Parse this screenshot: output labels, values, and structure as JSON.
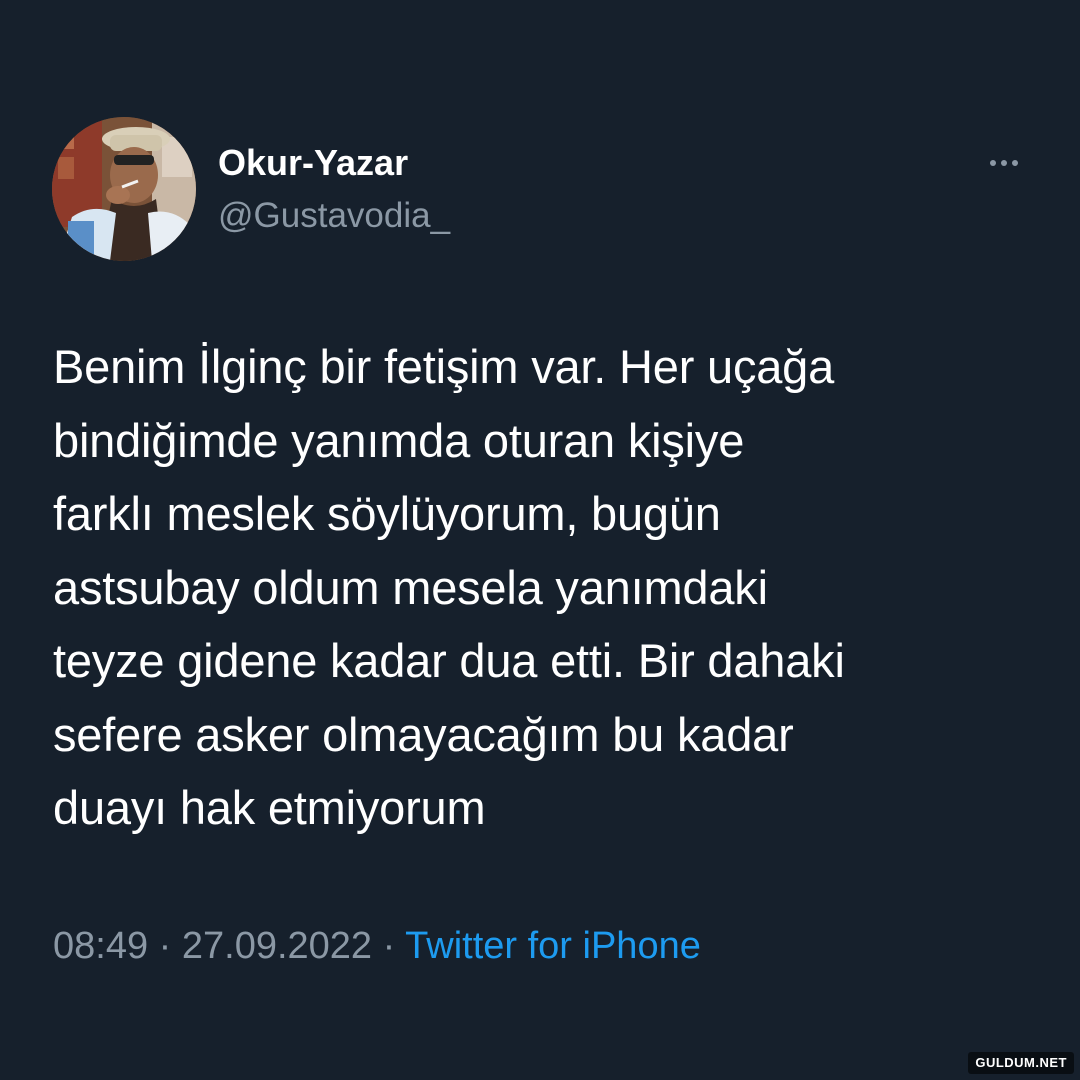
{
  "tweet": {
    "author": {
      "display_name": "Okur-Yazar",
      "handle": "@Gustavodia_",
      "avatar_icon": "profile-photo"
    },
    "more_icon": "more-horizontal-icon",
    "text_lines": [
      "Benim İlginç bir fetişim var. Her uçağa",
      "bindiğimde yanımda oturan kişiye",
      "farklı meslek söylüyorum, bugün",
      "astsubay oldum mesela yanımdaki",
      "teyze gidene kadar dua etti. Bir dahaki",
      "sefere asker olmayacağım bu kadar",
      "duayı hak etmiyorum"
    ],
    "time": "08:49",
    "separator": " · ",
    "date": "27.09.2022",
    "source": "Twitter for iPhone"
  },
  "watermark": "GULDUM.NET",
  "colors": {
    "background": "#16202c",
    "text": "#ffffff",
    "muted": "#8b98a5",
    "link": "#1d9bf0"
  }
}
